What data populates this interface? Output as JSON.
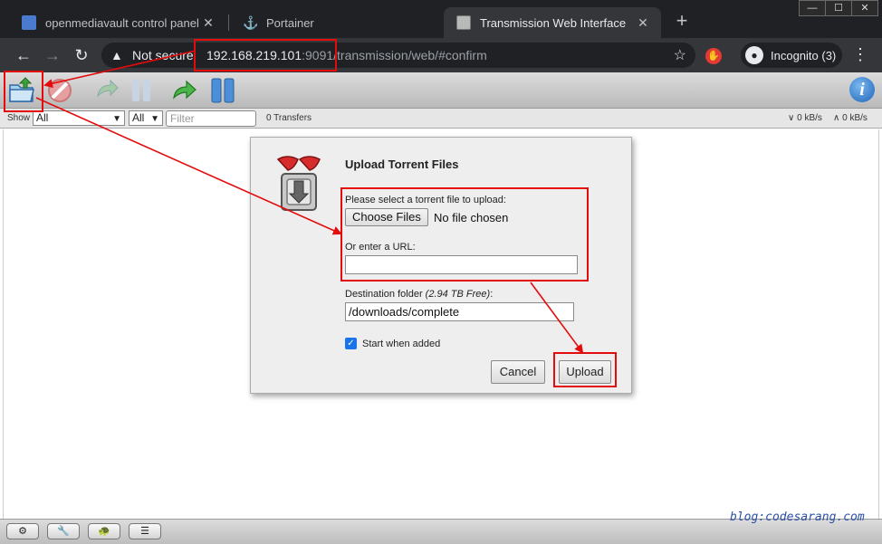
{
  "browser": {
    "tabs": [
      {
        "title": "openmediavault control panel - ▌",
        "active": false
      },
      {
        "title": "Portainer",
        "active": false
      },
      {
        "title": "Transmission Web Interface",
        "active": true
      }
    ],
    "window_buttons": [
      "—",
      "☐",
      "✕"
    ],
    "security_label": "Not secure",
    "url_host": "192.168.219.101",
    "url_rest": ":9091/transmission/web/#confirm",
    "incognito_label": "Incognito (3)"
  },
  "toolbar": {
    "icons": [
      "open-torrent-icon",
      "remove-icon",
      "resume-icon",
      "pause-icon",
      "resume-all-icon",
      "pause-all-icon",
      "info-icon"
    ]
  },
  "filter": {
    "show_label": "Show",
    "state_value": "All",
    "tracker_value": "All",
    "filter_placeholder": "Filter",
    "transfers": "0 Transfers",
    "down_speed": "∨ 0 kB/s",
    "up_speed": "∧ 0 kB/s"
  },
  "dialog": {
    "title": "Upload Torrent Files",
    "select_label": "Please select a torrent file to upload:",
    "choose_button": "Choose Files",
    "no_file": "No file chosen",
    "url_label": "Or enter a URL:",
    "url_value": "",
    "dest_label": "Destination folder",
    "dest_free": "(2.94 TB Free)",
    "dest_colon": ":",
    "dest_value": "/downloads/complete",
    "start_checked": true,
    "start_label": "Start when added",
    "cancel_button": "Cancel",
    "upload_button": "Upload"
  },
  "bottom": {
    "watermark": "blog:codesarang.com"
  },
  "colors": {
    "annotation_red": "#e30b0b",
    "chrome_dark": "#202124",
    "chrome_toolbar": "#35363a"
  }
}
